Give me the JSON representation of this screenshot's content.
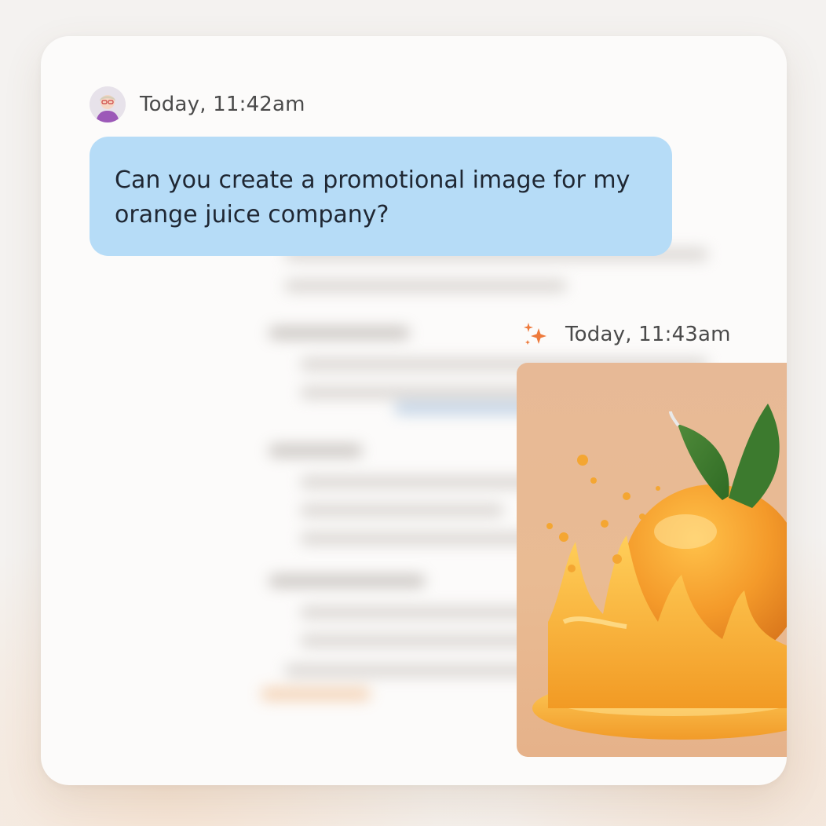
{
  "user_message": {
    "timestamp": "Today, 11:42am",
    "text": "Can you create a promotional image for my orange juice company?"
  },
  "ai_response": {
    "timestamp": "Today, 11:43am",
    "icon": "sparkle-icon",
    "image_subject": "orange-juice-splash-image"
  },
  "colors": {
    "user_bubble": "#b6dcf7",
    "card_background": "#fcfbfa",
    "sparkle_accent": "#ee7a3c",
    "image_background": "#e9bb93"
  },
  "icons": [
    "avatar",
    "sparkle-icon"
  ]
}
